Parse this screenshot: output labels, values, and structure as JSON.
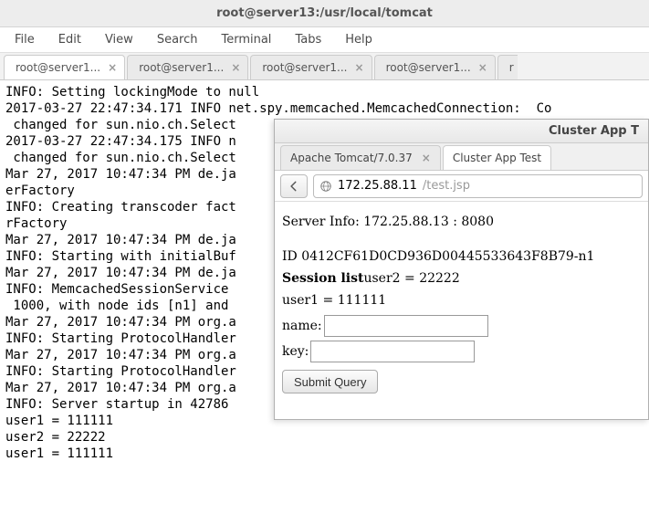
{
  "window": {
    "title": "root@server13:/usr/local/tomcat"
  },
  "menu": {
    "file": "File",
    "edit": "Edit",
    "view": "View",
    "search": "Search",
    "terminal": "Terminal",
    "tabs": "Tabs",
    "help": "Help"
  },
  "termtabs": {
    "t0": "root@server1...",
    "t1": "root@server1...",
    "t2": "root@server1...",
    "t3": "root@server1...",
    "t4": "r"
  },
  "terminal_text": "INFO: Setting lockingMode to null\n2017-03-27 22:47:34.171 INFO net.spy.memcached.MemcachedConnection:  Co\n changed for sun.nio.ch.Select\n2017-03-27 22:47:34.175 INFO n\n changed for sun.nio.ch.Select\nMar 27, 2017 10:47:34 PM de.ja\nerFactory\nINFO: Creating transcoder fact\nrFactory\nMar 27, 2017 10:47:34 PM de.ja\nINFO: Starting with initialBuf\nMar 27, 2017 10:47:34 PM de.ja\nINFO: MemcachedSessionService\n 1000, with node ids [n1] and\nMar 27, 2017 10:47:34 PM org.a\nINFO: Starting ProtocolHandler\nMar 27, 2017 10:47:34 PM org.a\nINFO: Starting ProtocolHandler\nMar 27, 2017 10:47:34 PM org.a\nINFO: Server startup in 42786\nuser1 = 111111\nuser2 = 22222\nuser1 = 111111",
  "browser": {
    "title": "Cluster App T",
    "tab0": "Apache Tomcat/7.0.37",
    "tab1": "Cluster App Test",
    "url_host": "172.25.88.11",
    "url_path": "/test.jsp"
  },
  "page": {
    "server_info_label": "Server Info: ",
    "server_info_value": "172.25.88.13 : 8080",
    "id_label": "ID ",
    "id_value": "0412CF61D0CD936D00445533643F8B79-n1",
    "session_label": "Session list",
    "session_value": "user2 = 22222",
    "line3": "user1 = 111111",
    "name_label": "name:",
    "key_label": "key:",
    "submit": "Submit Query"
  }
}
